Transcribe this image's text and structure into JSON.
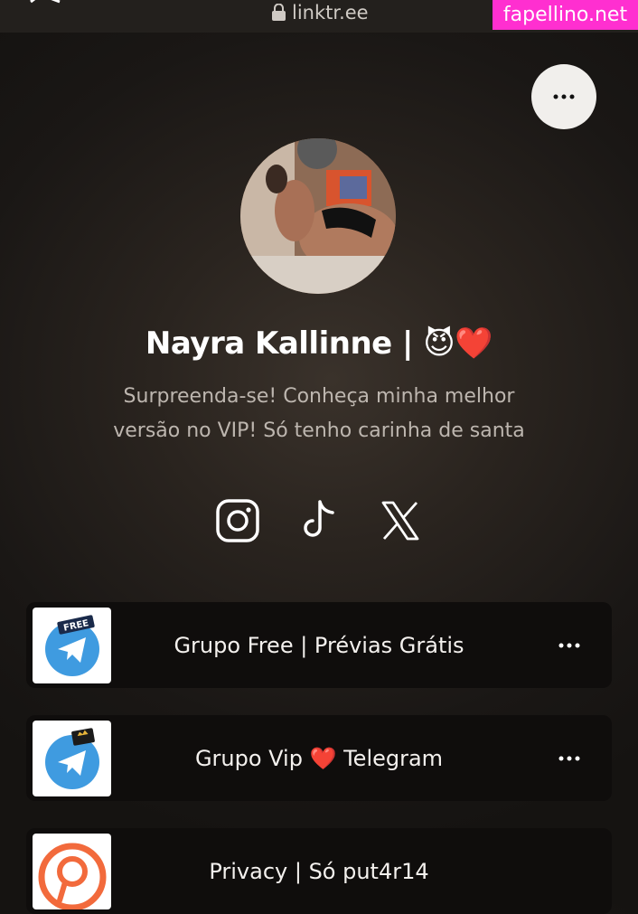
{
  "browser": {
    "url": "linktr.ee",
    "watermark": "fapellino.net"
  },
  "profile": {
    "name": "Nayra Kallinne | 😈❤️",
    "bio_line1": "Surpreenda-se! Conheça minha melhor",
    "bio_line2": "versão no VIP! Só tenho carinha de santa"
  },
  "socials": [
    "instagram-icon",
    "tiktok-icon",
    "x-icon"
  ],
  "links": [
    {
      "label": "Grupo Free | Prévias Grátis",
      "thumb_badge": "FREE"
    },
    {
      "label": "Grupo Vip ❤️ Telegram",
      "thumb_badge": "VIP"
    },
    {
      "label": "Privacy | Só put4r14",
      "thumb_badge": ""
    }
  ],
  "colors": {
    "telegram_blue": "#3f9be0",
    "privacy_orange": "#f26a3c",
    "watermark_pink": "#ff2fd0"
  }
}
